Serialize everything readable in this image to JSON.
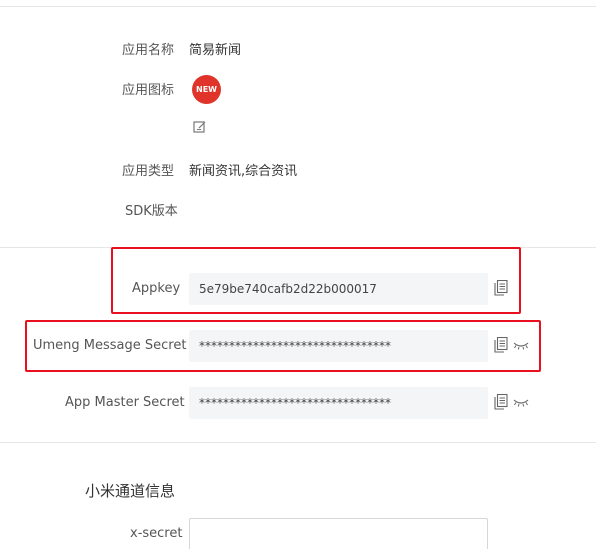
{
  "app_info": {
    "name_label": "应用名称",
    "name_value": "简易新闻",
    "icon_label": "应用图标",
    "icon_badge_text": "NEW",
    "type_label": "应用类型",
    "type_value": "新闻资讯,综合资讯",
    "sdk_label": "SDK版本",
    "sdk_value": ""
  },
  "keys": {
    "appkey_label": "Appkey",
    "appkey_value": "5e79be740cafb2d22b000017",
    "umeng_secret_label": "Umeng Message Secret",
    "umeng_secret_value": "********************************",
    "master_secret_label": "App Master Secret",
    "master_secret_value": "********************************"
  },
  "xiaomi": {
    "section_title": "小米通道信息",
    "xsecret_label": "x-secret",
    "xsecret_value": ""
  },
  "colors": {
    "badge": "#e0342b",
    "highlight_box": "#e8101e",
    "field_bg": "#f4f5f7"
  },
  "icons": [
    "edit-icon",
    "copy-icon",
    "eye-closed-icon"
  ]
}
